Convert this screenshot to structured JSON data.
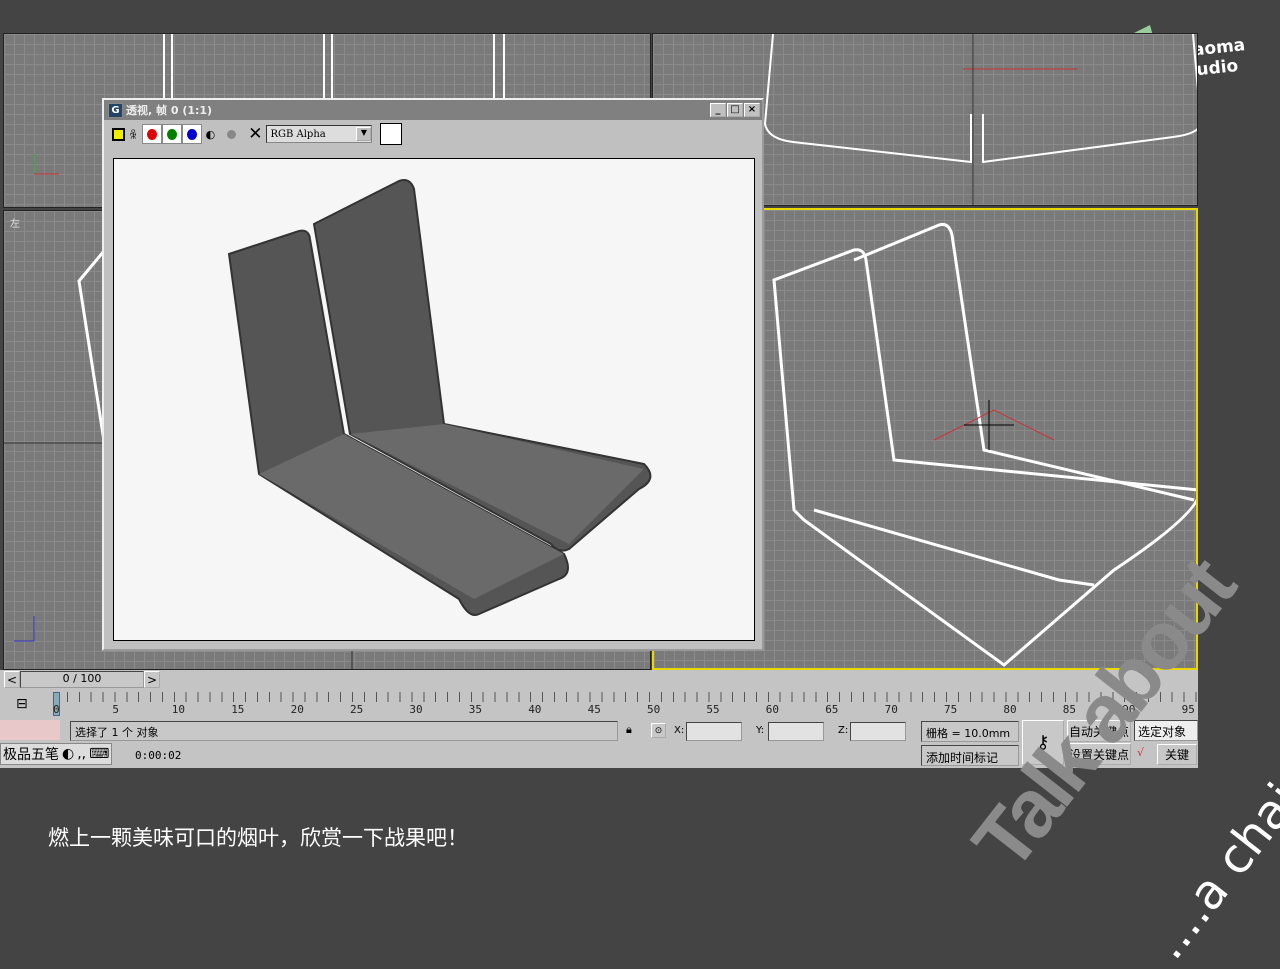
{
  "logo": {
    "text": "Xiaoma Studio"
  },
  "viewports": {
    "left_label": "左"
  },
  "render_window": {
    "title": "透视, 帧 0 (1:1)",
    "channel_select": "RGB Alpha",
    "icons": [
      "save-icon",
      "clone-icon",
      "red-channel-icon",
      "green-channel-icon",
      "blue-channel-icon",
      "mono-icon",
      "alpha-icon",
      "clear-icon"
    ],
    "colors": {
      "red": "#e00000",
      "green": "#008000",
      "blue": "#0000d0"
    }
  },
  "timeline": {
    "frame": "0 / 100",
    "ticks": [
      "0",
      "5",
      "10",
      "15",
      "20",
      "25",
      "30",
      "35",
      "40",
      "45",
      "50",
      "55",
      "60",
      "65",
      "70",
      "75",
      "80",
      "85",
      "90",
      "95"
    ],
    "progress": 0
  },
  "status": {
    "selection": "选择了 1 个 对象",
    "x_label": "X:",
    "y_label": "Y:",
    "z_label": "Z:",
    "grid": "栅格 = 10.0mm",
    "add_time_tag": "添加时间标记",
    "auto_key": "自动关键点",
    "set_key": "设置关键点",
    "selected_object": "选定对象",
    "key_filters": "关键",
    "time": "0:00:02",
    "ime": "极品五笔"
  },
  "caption": "燃上一颗美味可口的烟叶，欣赏一下战果吧！",
  "watermark": {
    "line1": "Talk about",
    "line2": "....a chair"
  }
}
